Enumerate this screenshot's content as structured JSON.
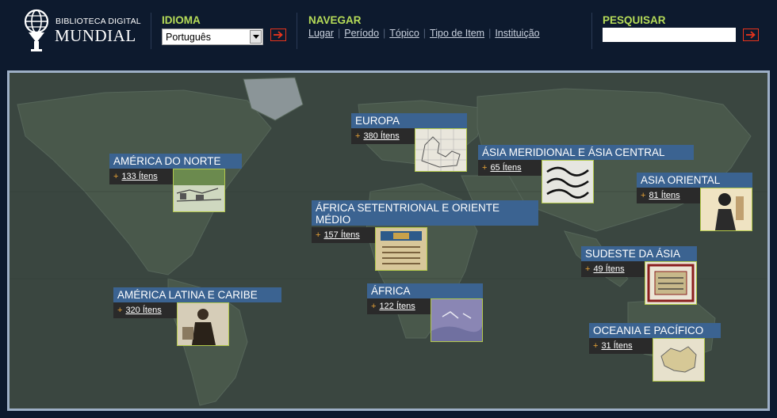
{
  "header": {
    "logo": {
      "line1": "BIBLIOTECA DIGITAL",
      "line2": "MUNDIAL"
    },
    "language": {
      "label": "IDIOMA",
      "selected": "Português"
    },
    "browse": {
      "label": "NAVEGAR",
      "links": [
        "Lugar",
        "Período",
        "Tópico",
        "Tipo de Item",
        "Instituição"
      ]
    },
    "search": {
      "label": "PESQUISAR",
      "value": ""
    }
  },
  "colors": {
    "background": "#0d1a2e",
    "header_label": "#b6dc58",
    "region_title": "#3b6391",
    "go_button": "#e8341c",
    "thumb_border": "#b3c84a",
    "plus": "#e8a236"
  },
  "regions": [
    {
      "title": "EUROPA",
      "count": "380 Ítens"
    },
    {
      "title": "AMÉRICA DO NORTE",
      "count": "133 Ítens"
    },
    {
      "title": "ÁSIA MERIDIONAL E ÁSIA CENTRAL",
      "count": "65 Ítens"
    },
    {
      "title": "ASIA ORIENTAL",
      "count": "81 Ítens"
    },
    {
      "title": "ÁFRICA SETENTRIONAL E ORIENTE MÉDIO",
      "count": "157 Ítens"
    },
    {
      "title": "SUDESTE DA ÁSIA",
      "count": "49 Ítens"
    },
    {
      "title": "AMÉRICA LATINA E CARIBE",
      "count": "320 Ítens"
    },
    {
      "title": "ÁFRICA",
      "count": "122 Ítens"
    },
    {
      "title": "OCEANIA E PACÍFICO",
      "count": "31 Ítens"
    }
  ]
}
